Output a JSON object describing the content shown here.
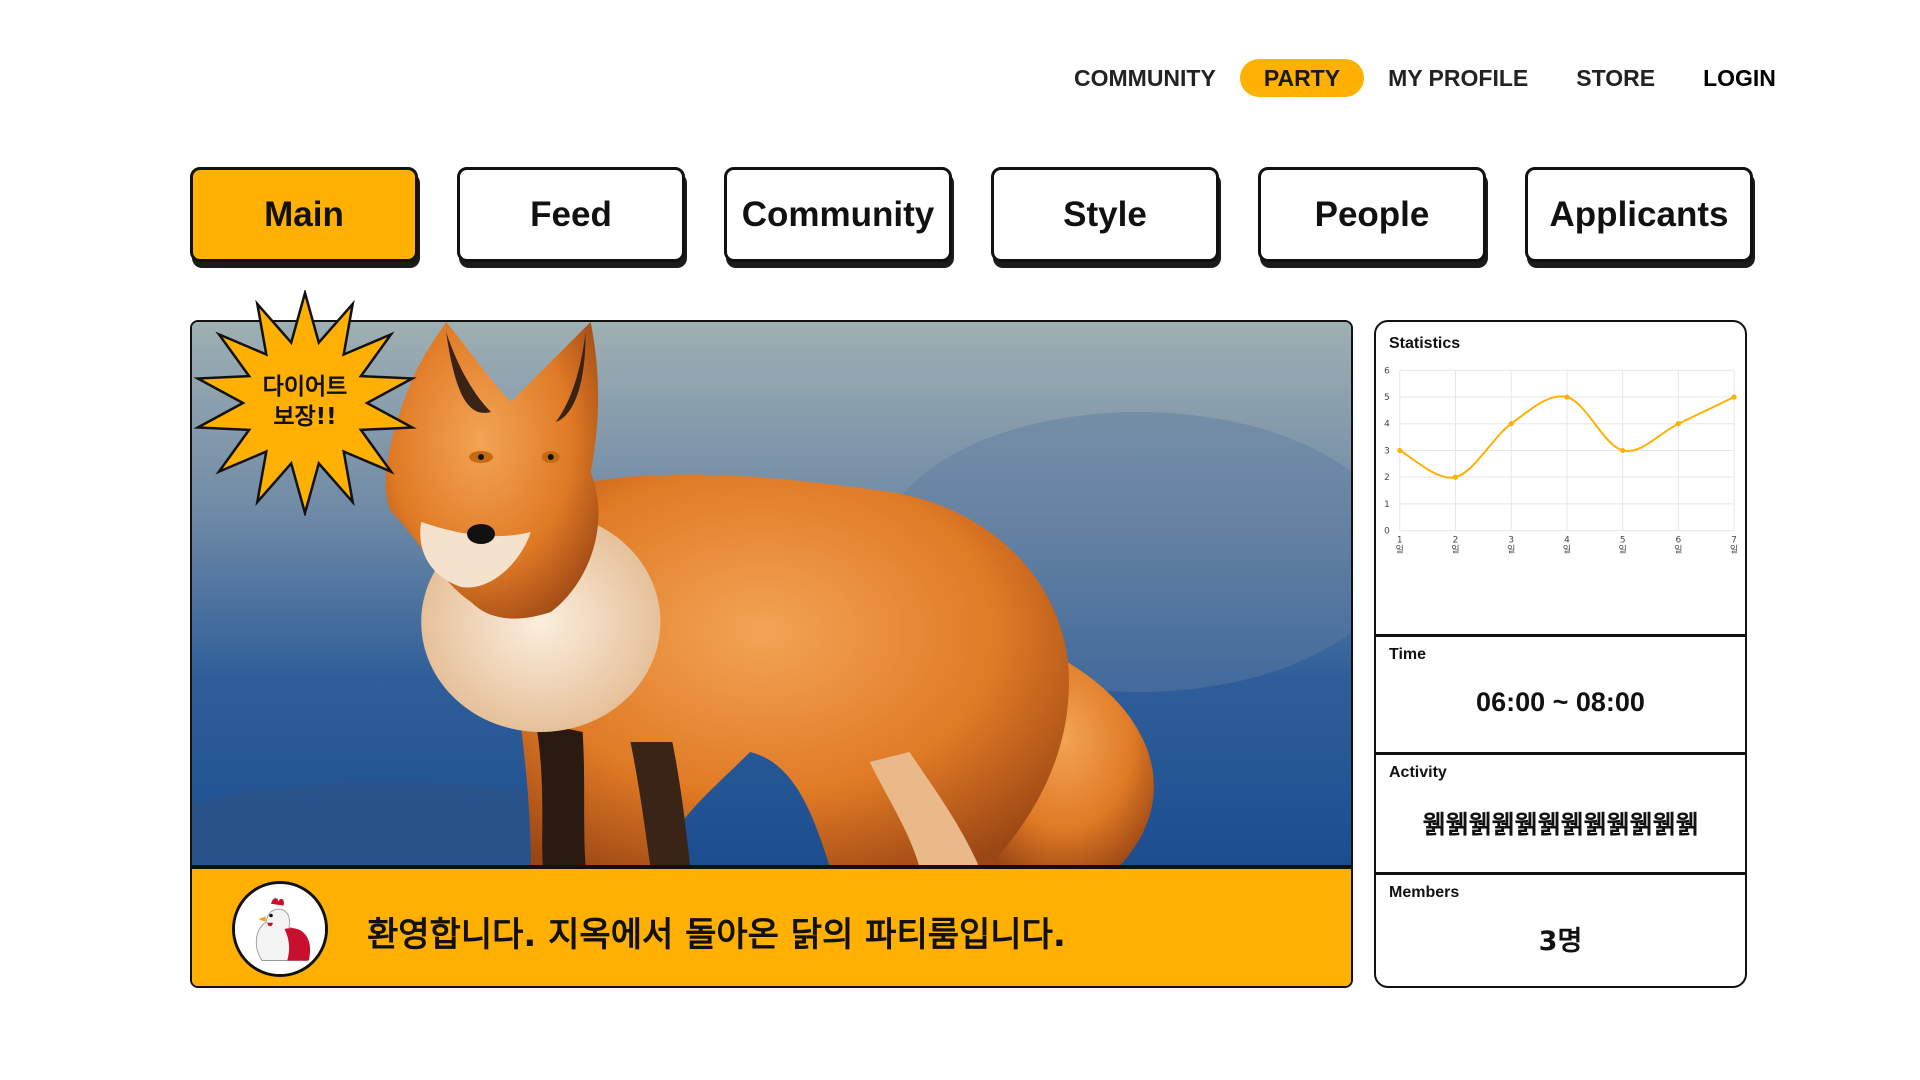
{
  "topnav": {
    "items": [
      {
        "label": "COMMUNITY",
        "active": false
      },
      {
        "label": "PARTY",
        "active": true
      },
      {
        "label": "MY PROFILE",
        "active": false
      },
      {
        "label": "STORE",
        "active": false
      },
      {
        "label": "LOGIN",
        "active": false
      }
    ]
  },
  "tabs": [
    {
      "label": "Main",
      "active": true
    },
    {
      "label": "Feed",
      "active": false
    },
    {
      "label": "Community",
      "active": false
    },
    {
      "label": "Style",
      "active": false
    },
    {
      "label": "People",
      "active": false
    },
    {
      "label": "Applicants",
      "active": false
    }
  ],
  "hero": {
    "badge_line1": "다이어트",
    "badge_line2": "보장!!",
    "banner_text": "환영합니다. 지옥에서 돌아온 닭의 파티룸입니다.",
    "avatar_icon": "chicken-icon"
  },
  "side": {
    "statistics_label": "Statistics",
    "time_label": "Time",
    "time_value": "06:00 ~ 08:00",
    "activity_label": "Activity",
    "activity_value": "웱웱웱웱웱웱웱웱웱웱웱웱",
    "members_label": "Members",
    "members_value": "3명"
  },
  "colors": {
    "accent": "#FFB000",
    "border": "#111111"
  },
  "chart_data": {
    "type": "line",
    "title": "Statistics",
    "categories": [
      "1일",
      "2일",
      "3일",
      "4일",
      "5일",
      "6일",
      "7일"
    ],
    "series": [
      {
        "values": [
          3,
          2,
          4,
          5,
          3,
          4,
          5
        ]
      }
    ],
    "ylim": [
      0,
      6
    ],
    "yticks": [
      0,
      1,
      2,
      3,
      4,
      5,
      6
    ],
    "grid": true,
    "line_color": "#FFB000"
  }
}
